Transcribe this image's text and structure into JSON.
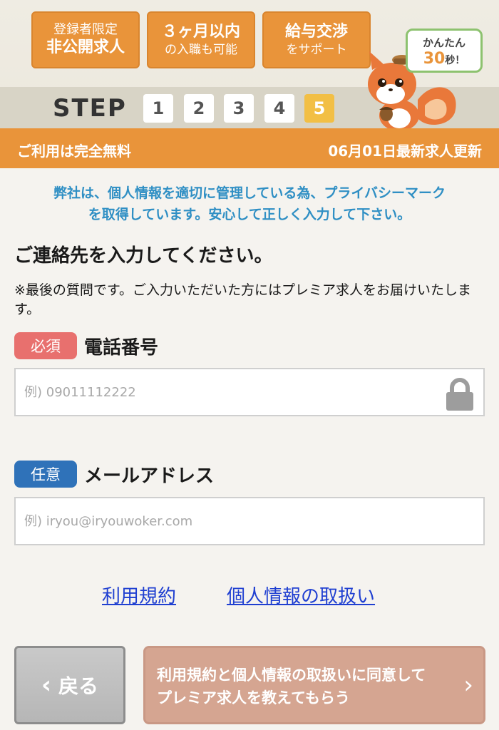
{
  "header": {
    "badges": [
      {
        "line1": "登録者限定",
        "line2": "非公開求人"
      },
      {
        "line1": "３ヶ月以内",
        "line2": "の入職も可能"
      },
      {
        "line1": "給与交渉",
        "line2": "をサポート"
      }
    ],
    "bubble": {
      "line1": "かんたん",
      "number": "30",
      "suffix": "秒！"
    },
    "step_label": "STEP",
    "steps": [
      "1",
      "2",
      "3",
      "4",
      "5"
    ],
    "active_step": 5,
    "free_text": "ご利用は完全無料",
    "update_text": "06月01日最新求人更新"
  },
  "privacy_notice": {
    "line1": "弊社は、個人情報を適切に管理している為、プライバシーマーク",
    "line2": "を取得しています。安心して正しく入力して下さい。"
  },
  "form": {
    "heading": "ご連絡先を入力してください。",
    "note": "※最後の質問です。ご入力いただいた方にはプレミア求人をお届けいたします。",
    "phone": {
      "tag": "必須",
      "label": "電話番号",
      "placeholder": "例) 09011112222"
    },
    "email": {
      "tag": "任意",
      "label": "メールアドレス",
      "placeholder": "例) iryou@iryouwoker.com"
    }
  },
  "links": {
    "terms": "利用規約",
    "privacy": "個人情報の取扱い"
  },
  "buttons": {
    "back": "戻る",
    "submit_line1": "利用規約と個人情報の取扱いに同意して",
    "submit_line2": "プレミア求人を教えてもらう"
  },
  "colors": {
    "accent": "#e9943a",
    "active_step": "#f2bf45",
    "required": "#e8706e",
    "optional": "#2f72b9",
    "link": "#1f3fd1"
  }
}
